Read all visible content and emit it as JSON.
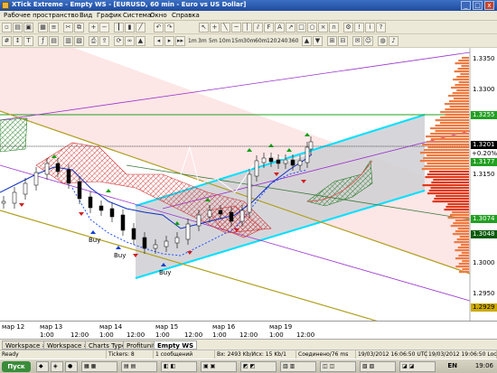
{
  "window": {
    "title": "XTick Extreme - Empty WS - [EURUSD, 60 min - Euro vs US Dollar]",
    "min_label": "_",
    "max_label": "□",
    "close_label": "x"
  },
  "menu": [
    "Рабочее пространство",
    "Вид",
    "График",
    "Система",
    "Окно",
    "Справка"
  ],
  "timeframes": [
    "1m",
    "3m",
    "5m",
    "10m",
    "15m",
    "30m",
    "60m",
    "120",
    "240",
    "360"
  ],
  "chart": {
    "price_labels": [
      "1.3350",
      "1.3300",
      "1.3255",
      "1.3201",
      "1.3177",
      "1.3150",
      "1.3074",
      "1.3048",
      "1.3000",
      "1.2950",
      "1.2929"
    ],
    "tags": {
      "green1": "1.3255",
      "last": "1.3201",
      "change": "+0.20%",
      "ref": "1.3177",
      "green2": "1.3074",
      "green3": "1.3048",
      "green4": "1.2929"
    },
    "signals": [
      "Buy",
      "Buy",
      "Buy"
    ],
    "time_labels": [
      "мар 12",
      "мар 13",
      "1:00",
      "12:00",
      "мар 14",
      "1:00",
      "12:00",
      "мар 15",
      "1:00",
      "12:00",
      "мар 16",
      "1:00",
      "12:00",
      "мар 19",
      "1:00",
      "12:00"
    ],
    "colors": {
      "channel_fill": "#c8c8c8",
      "channel_edge": "#00e0ff",
      "cloud_red": "#e04040",
      "cloud_green": "#208020",
      "volume_profile": "#f07a40",
      "purple_line": "#9933cc",
      "olive_line": "#b0a020"
    }
  },
  "tabs": [
    "Workspace #1",
    "Workspace #2",
    "Charts Types",
    "Profitunity",
    "Empty WS"
  ],
  "status": {
    "ready": "Ready",
    "tickers": "Tickers: 8",
    "messages": "1 сообщений",
    "speed": "Вх: 2493 Kb/Исх: 15 Kb/1",
    "connection": "Соединено/76 ms",
    "utc": "19/03/2012 16:06:50 UTC",
    "local": "19/03/2012 19:06:50 Local"
  },
  "taskbar": {
    "start": "Пуск",
    "lang": "EN",
    "clock": "19:06"
  }
}
